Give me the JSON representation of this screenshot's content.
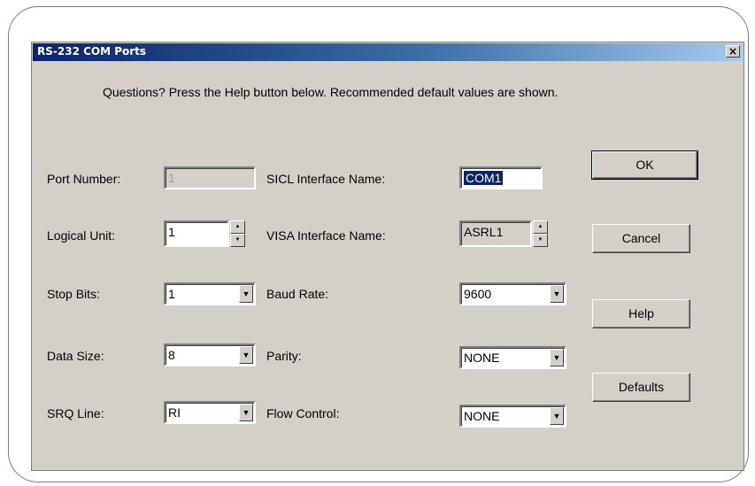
{
  "window": {
    "title": "RS-232 COM Ports",
    "close_glyph": "×"
  },
  "intro": "Questions? Press the Help button below.  Recommended default values are shown.",
  "fields": {
    "port_number": {
      "label": "Port Number:",
      "value": "1"
    },
    "logical_unit": {
      "label": "Logical Unit:",
      "value": "1"
    },
    "stop_bits": {
      "label": "Stop Bits:",
      "value": "1"
    },
    "data_size": {
      "label": "Data Size:",
      "value": "8"
    },
    "srq_line": {
      "label": "SRQ Line:",
      "value": "RI"
    },
    "sicl_interface": {
      "label": "SICL Interface Name:",
      "value": "COM1"
    },
    "visa_interface": {
      "label": "VISA Interface Name:",
      "value": "ASRL1"
    },
    "baud_rate": {
      "label": "Baud Rate:",
      "value": "9600"
    },
    "parity": {
      "label": "Parity:",
      "value": "NONE"
    },
    "flow_control": {
      "label": "Flow Control:",
      "value": "NONE"
    }
  },
  "buttons": {
    "ok": "OK",
    "cancel": "Cancel",
    "help": "Help",
    "defaults": "Defaults"
  },
  "icons": {
    "dropdown": "▼",
    "spin_up": "▲",
    "spin_down": "▼"
  }
}
